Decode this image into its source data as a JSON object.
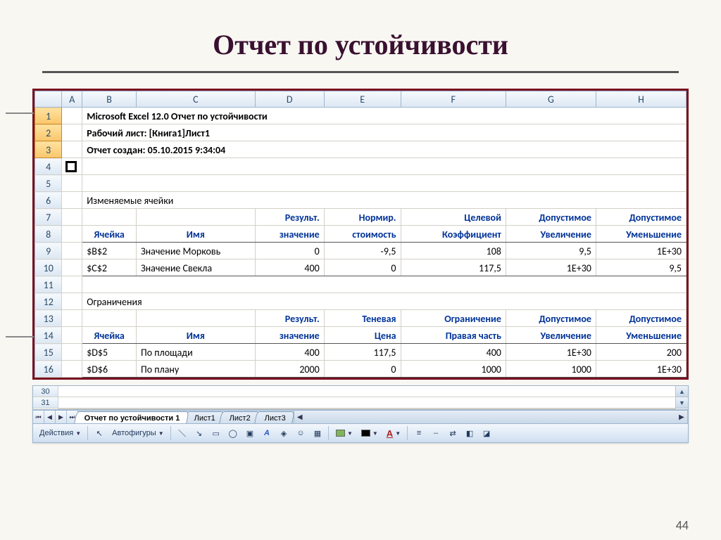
{
  "slide": {
    "title": "Отчет по устойчивости",
    "page_number": "44"
  },
  "report": {
    "header1": "Microsoft Excel 12.0 Отчет по устойчивости",
    "header2": "Рабочий лист: [Книга1]Лист1",
    "header3": "Отчет создан: 05.10.2015 9:34:04",
    "section1_label": "Изменяемые ячейки",
    "section2_label": "Ограничения",
    "columns": [
      "A",
      "B",
      "C",
      "D",
      "E",
      "F",
      "G",
      "H"
    ],
    "rows": [
      "1",
      "2",
      "3",
      "4",
      "5",
      "6",
      "7",
      "8",
      "9",
      "10",
      "11",
      "12",
      "13",
      "14",
      "15",
      "16"
    ],
    "hdr1": {
      "d7": "Результ.",
      "e7": "Нормир.",
      "f7": "Целевой",
      "g7": "Допустимое",
      "h7": "Допустимое",
      "b8": "Ячейка",
      "c8": "Имя",
      "d8": "значение",
      "e8": "стоимость",
      "f8": "Коэффициент",
      "g8": "Увеличение",
      "h8": "Уменьшение"
    },
    "vars": [
      {
        "cell": "$B$2",
        "name": "Значение Морковь",
        "res": "0",
        "norm": "-9,5",
        "coef": "108",
        "up": "9,5",
        "down": "1E+30"
      },
      {
        "cell": "$C$2",
        "name": "Значение Свекла",
        "res": "400",
        "norm": "0",
        "coef": "117,5",
        "up": "1E+30",
        "down": "9,5"
      }
    ],
    "hdr2": {
      "d13": "Результ.",
      "e13": "Теневая",
      "f13": "Ограничение",
      "g13": "Допустимое",
      "h13": "Допустимое",
      "b14": "Ячейка",
      "c14": "Имя",
      "d14": "значение",
      "e14": "Цена",
      "f14": "Правая часть",
      "g14": "Увеличение",
      "h14": "Уменьшение"
    },
    "cons": [
      {
        "cell": "$D$5",
        "name": "По площади",
        "res": "400",
        "shadow": "117,5",
        "rhs": "400",
        "up": "1E+30",
        "down": "200"
      },
      {
        "cell": "$D$6",
        "name": "По плану",
        "res": "2000",
        "shadow": "0",
        "rhs": "1000",
        "up": "1000",
        "down": "1E+30"
      }
    ]
  },
  "bottom": {
    "row30": "30",
    "row31": "31",
    "tabs": [
      "Отчет по устойчивости 1",
      "Лист1",
      "Лист2",
      "Лист3"
    ],
    "active_tab": 0,
    "toolbar": {
      "actions": "Действия",
      "auto": "Автофигуры"
    }
  }
}
